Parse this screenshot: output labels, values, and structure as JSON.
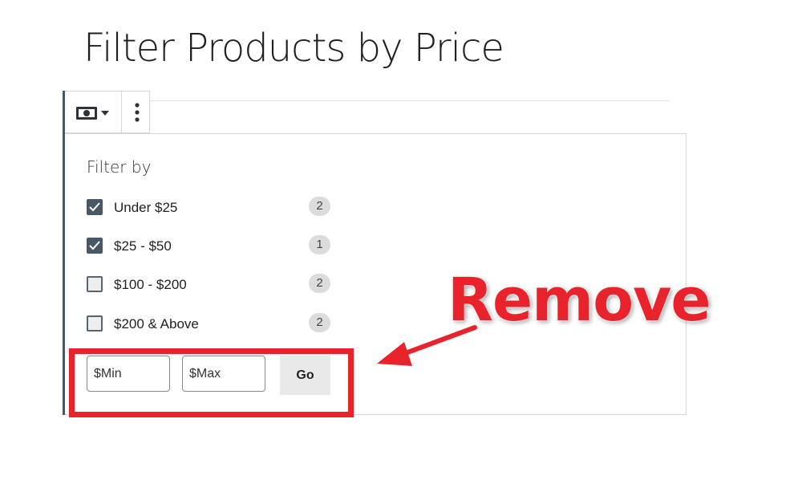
{
  "page": {
    "title": "Filter Products by Price"
  },
  "toolbar": {
    "block_icon": "money-bill-icon",
    "dropdown_icon": "caret-down-icon",
    "more_icon": "vertical-ellipsis-icon"
  },
  "filter": {
    "heading": "Filter by",
    "options": [
      {
        "label": "Under $25",
        "count": "2",
        "checked": true
      },
      {
        "label": "$25 - $50",
        "count": "1",
        "checked": true
      },
      {
        "label": "$100 - $200",
        "count": "2",
        "checked": false
      },
      {
        "label": "$200 & Above",
        "count": "2",
        "checked": false
      }
    ],
    "min_placeholder": "$Min",
    "max_placeholder": "$Max",
    "go_label": "Go"
  },
  "annotation": {
    "callout_text": "Remove",
    "color": "#e8232c",
    "arrow_icon": "arrow-left-icon"
  }
}
